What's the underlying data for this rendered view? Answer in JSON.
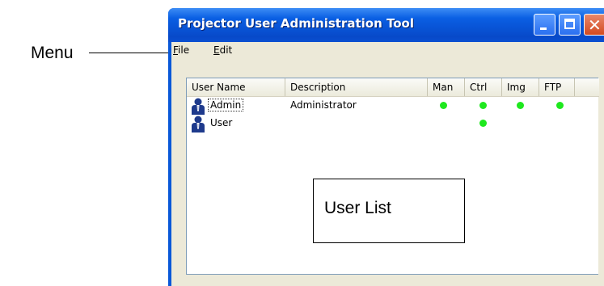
{
  "annotations": {
    "menu": "Menu",
    "user_list": "User List"
  },
  "window": {
    "title": "Projector User Administration Tool",
    "controls": {
      "minimize": "minimize-icon",
      "maximize": "maximize-icon",
      "close": "close-icon"
    }
  },
  "menubar": {
    "items": [
      {
        "mnemonic": "F",
        "rest": "ile"
      },
      {
        "mnemonic": "E",
        "rest": "dit"
      }
    ]
  },
  "listview": {
    "columns": [
      "User Name",
      "Description",
      "Man",
      "Ctrl",
      "Img",
      "FTP"
    ],
    "rows": [
      {
        "icon": "user-icon",
        "name": "Admin",
        "description": "Administrator",
        "man": true,
        "ctrl": true,
        "img": true,
        "ftp": true
      },
      {
        "icon": "user-icon",
        "name": "User",
        "description": "",
        "man": false,
        "ctrl": true,
        "img": false,
        "ftp": false
      }
    ]
  },
  "colors": {
    "titlebar": "#0a5fe3",
    "client_bg": "#ece9d8",
    "permission_dot": "#1ee81e",
    "close_button": "#d34a1f"
  }
}
